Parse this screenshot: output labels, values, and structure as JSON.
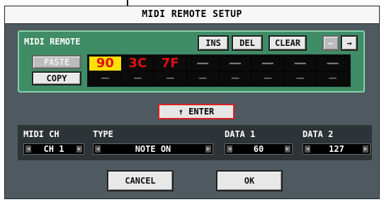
{
  "title": "MIDI REMOTE SETUP",
  "remote": {
    "label": "MIDI REMOTE",
    "buttons": {
      "ins": "INS",
      "del": "DEL",
      "clear": "CLEAR",
      "prev": "←",
      "next": "→",
      "paste": "PASTE",
      "copy": "COPY"
    },
    "row1": [
      "90",
      "3C",
      "7F",
      "—",
      "—",
      "—",
      "—",
      "—"
    ],
    "row2": [
      "—",
      "—",
      "—",
      "—",
      "—",
      "—",
      "—",
      "—"
    ]
  },
  "enter_label": "↑ ENTER",
  "params": {
    "midi_ch": {
      "label": "MIDI CH",
      "value": "CH 1"
    },
    "type": {
      "label": "TYPE",
      "value": "NOTE ON"
    },
    "data1": {
      "label": "DATA 1",
      "value": "60"
    },
    "data2": {
      "label": "DATA 2",
      "value": "127"
    }
  },
  "footer": {
    "cancel": "CANCEL",
    "ok": "OK"
  }
}
